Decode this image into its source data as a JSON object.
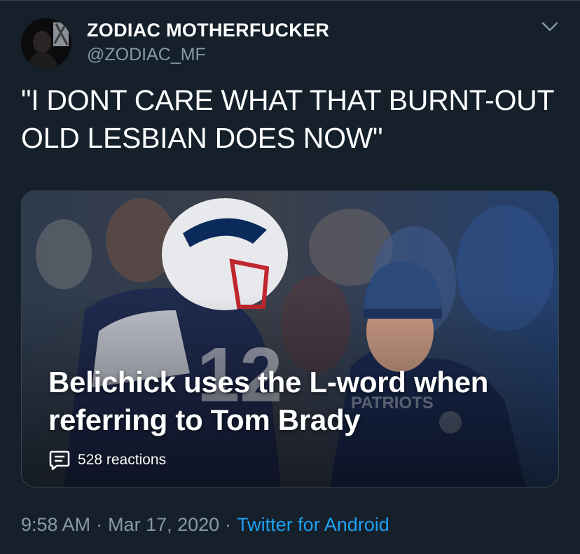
{
  "tweet": {
    "author": {
      "display_name": "ZODIAC MOTHERFUCKER",
      "handle": "@ZODIAC_MF",
      "avatar_icon": "profile-photo"
    },
    "menu_icon": "chevron-down-icon",
    "text": "\"I DONT CARE WHAT THAT BURNT-OUT OLD LESBIAN DOES NOW\"",
    "card": {
      "headline": "Belichick uses the L-word when referring to Tom Brady",
      "reactions_icon": "speech-bubble-icon",
      "reactions_label": "528 reactions"
    },
    "meta": {
      "time": "9:58 AM",
      "separator": "·",
      "date": "Mar 17, 2020",
      "source": "Twitter for Android"
    }
  },
  "colors": {
    "background": "#15202b",
    "secondary_text": "#8899a6",
    "link": "#1da1f2",
    "border": "#38444d"
  }
}
